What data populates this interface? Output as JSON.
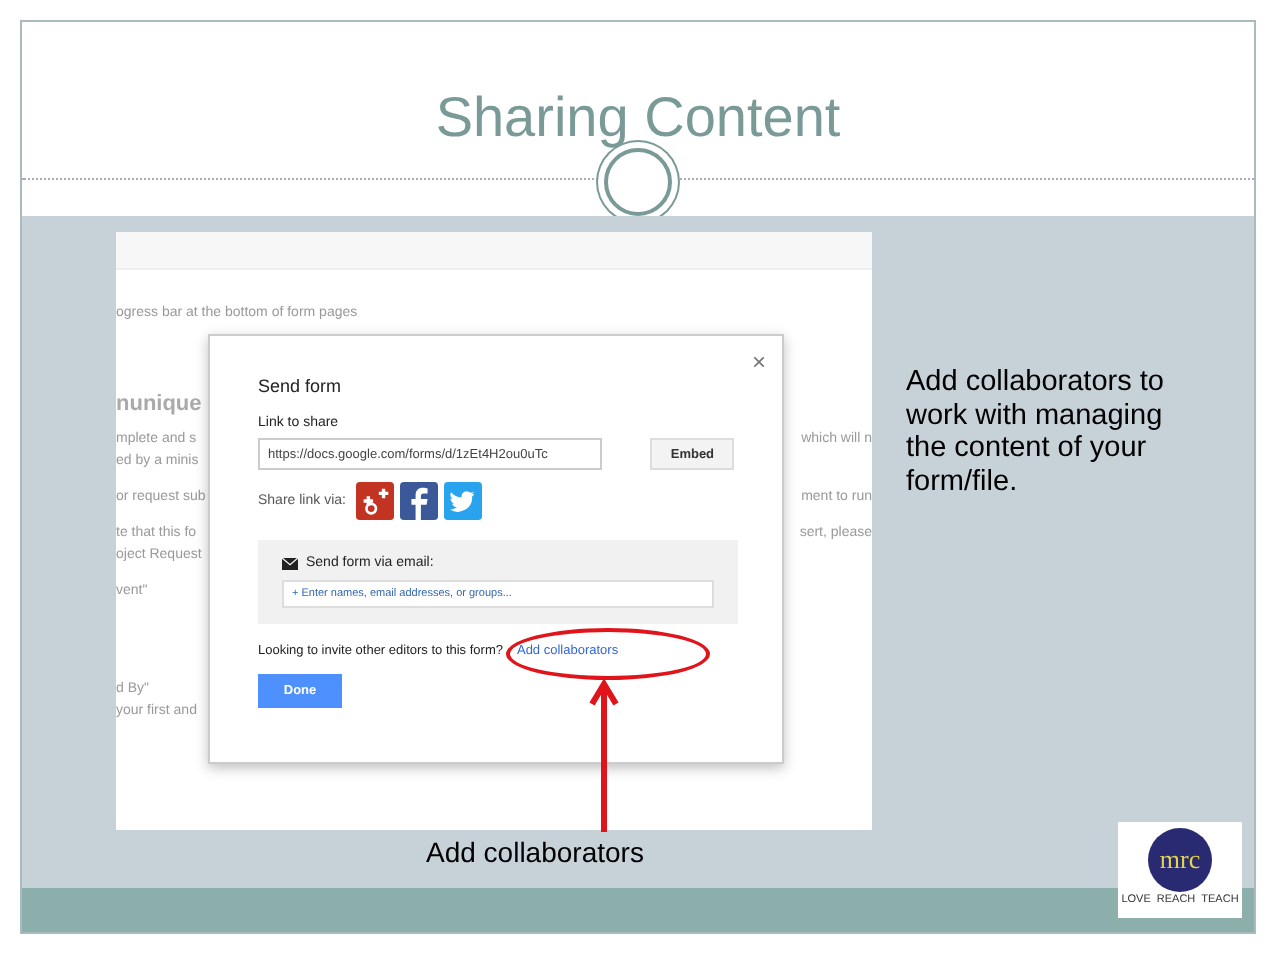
{
  "slide": {
    "title": "Sharing Content"
  },
  "background_form": {
    "rows": [
      {
        "kind": "line",
        "left": "ogress bar at the bottom of form pages",
        "right": ""
      },
      {
        "kind": "heading",
        "left": "nunique",
        "right": ""
      },
      {
        "kind": "line",
        "left": "mplete and s",
        "right": "which will n"
      },
      {
        "kind": "line",
        "left": "ed by a minis",
        "right": ""
      },
      {
        "kind": "gap",
        "left": "or request sub",
        "right": "ment to run"
      },
      {
        "kind": "gap",
        "left": "te that this fo",
        "right": "sert, please"
      },
      {
        "kind": "line",
        "left": "oject Request",
        "right": ""
      },
      {
        "kind": "gap",
        "left": "vent\"",
        "right": ""
      },
      {
        "kind": "big",
        "left": "d By\"",
        "right": ""
      },
      {
        "kind": "line",
        "left": "your first and",
        "right": ""
      }
    ]
  },
  "dialog": {
    "title": "Send form",
    "close": "×",
    "link_label": "Link to share",
    "link_value": "https://docs.google.com/forms/d/1zEt4H2ou0uTc",
    "embed_button": "Embed",
    "share_label": "Share link via:",
    "email_label": "Send form via email:",
    "email_placeholder": "+ Enter names, email addresses, or groups...",
    "invite_text": "Looking to invite other editors to this form?",
    "invite_link": "Add collaborators",
    "done_button": "Done"
  },
  "callout": "Add collaborators to work with managing the content of your form/file.",
  "annotation_label": "Add collaborators",
  "logo": {
    "text": "mrc",
    "tagline": [
      "LOVE",
      "REACH",
      "TEACH"
    ]
  }
}
